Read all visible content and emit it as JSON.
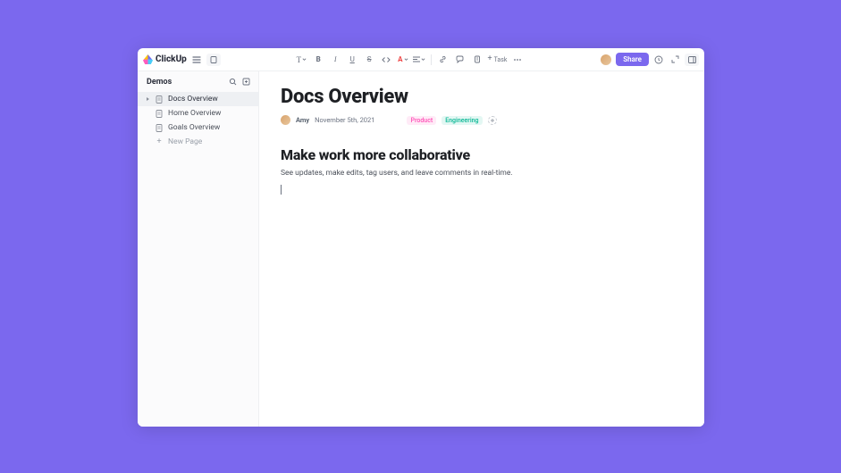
{
  "topbar": {
    "brand": "ClickUp",
    "text_style_label": "T",
    "task_label": "Task",
    "share_label": "Share"
  },
  "sidebar": {
    "title": "Demos",
    "items": [
      {
        "label": "Docs Overview"
      },
      {
        "label": "Home Overview"
      },
      {
        "label": "Goals Overview"
      }
    ],
    "new_page_label": "New Page"
  },
  "doc": {
    "title": "Docs Overview",
    "author": "Amy",
    "date": "November 5th, 2021",
    "tags": {
      "product": "Product",
      "engineering": "Engineering"
    },
    "heading": "Make work more collaborative",
    "body": "See updates, make edits, tag users, and leave comments in real-time."
  }
}
